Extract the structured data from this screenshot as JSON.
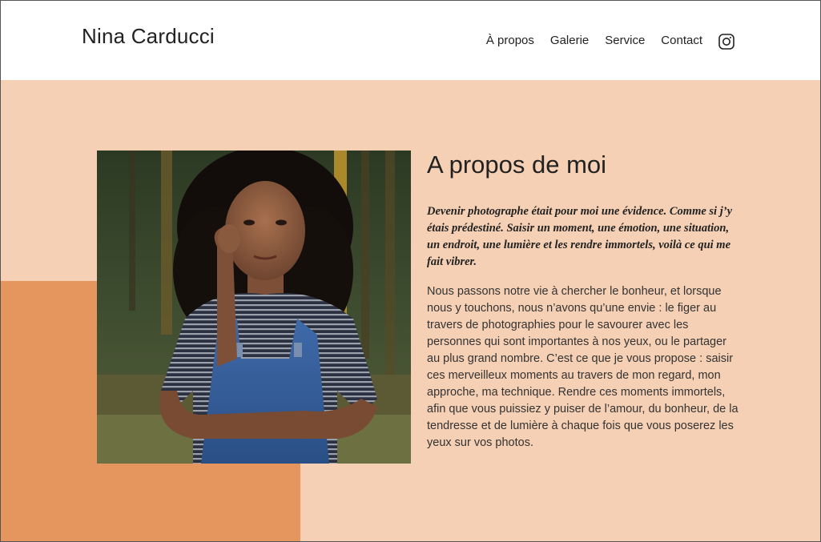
{
  "header": {
    "site_title": "Nina Carducci",
    "nav": [
      {
        "label": "À propos"
      },
      {
        "label": "Galerie"
      },
      {
        "label": "Service"
      },
      {
        "label": "Contact"
      }
    ],
    "social_icon": "instagram-icon"
  },
  "about": {
    "title": "A propos de moi",
    "lead": "Devenir photographe était pour moi une évidence. Comme si j’y étais prédestiné. Saisir un moment, une émotion, une situation, un endroit, une lumière et les rendre immortels, voilà ce qui me fait vibrer.",
    "body": "Nous passons notre vie à chercher le bonheur, et lorsque nous y touchons, nous n’avons qu’une envie : le figer au travers de photographies pour le savourer avec les personnes qui sont importantes à nos yeux, ou le partager au plus grand nombre. C’est ce que je vous propose : saisir ces merveilleux moments au travers de mon regard, mon approche, ma technique. Rendre ces moments immortels, afin que vous puissiez y puiser de l’amour, du bonheur, de la tendresse et de lumière à chaque fois que vous poserez les yeux sur vos photos."
  },
  "colors": {
    "background_light": "#f5d0b4",
    "accent": "#e5965f",
    "text": "#222222"
  }
}
